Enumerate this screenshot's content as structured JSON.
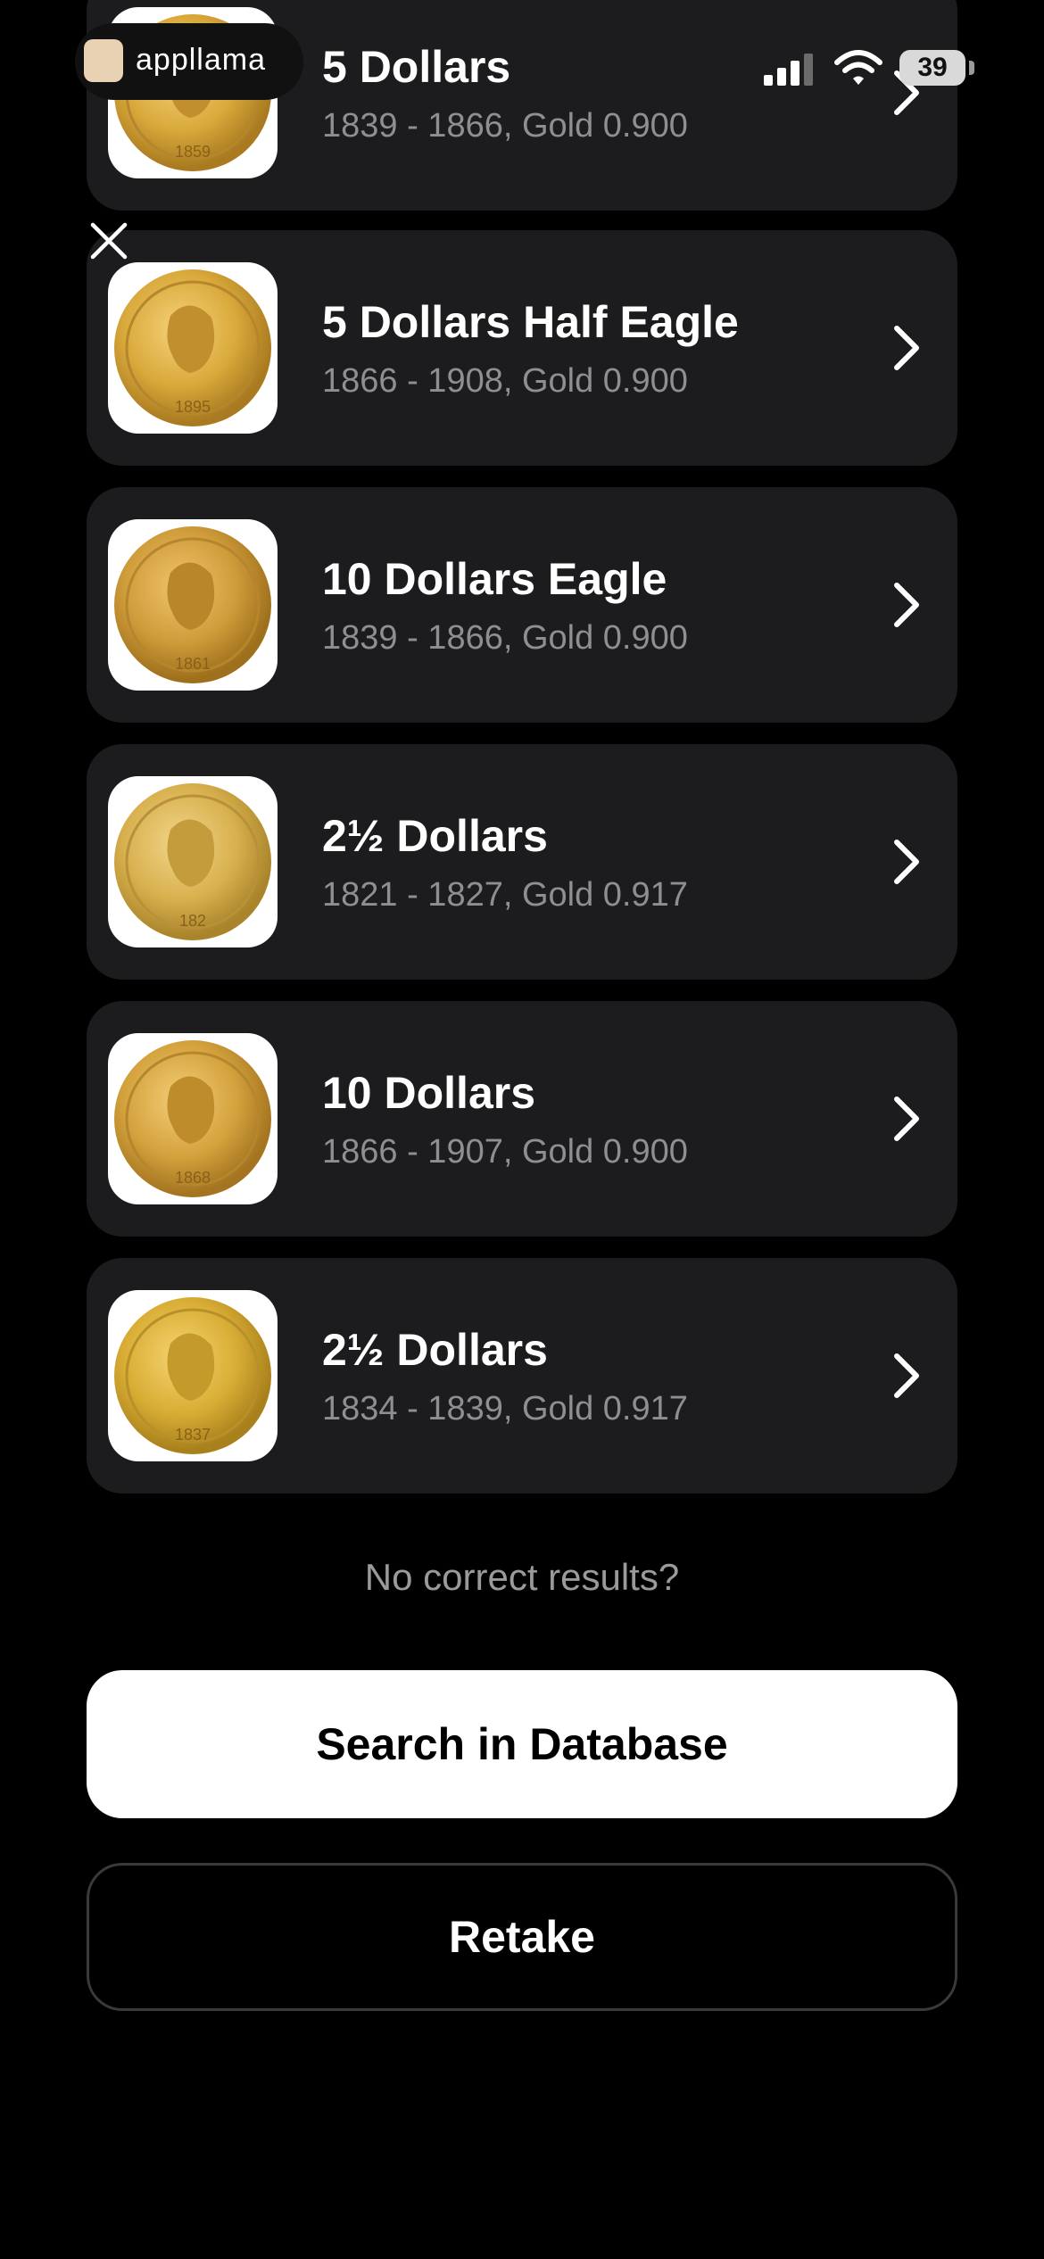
{
  "status_bar": {
    "app_label": "appllama",
    "battery_level": "39",
    "icons": [
      "llama-icon",
      "cellular-signal-icon",
      "wifi-icon",
      "battery-icon"
    ]
  },
  "close_icon": "close-icon",
  "results": [
    {
      "title": "5 Dollars",
      "subtitle": "1839 - 1866, Gold 0.900",
      "coin_year": "1859"
    },
    {
      "title": "5 Dollars Half Eagle",
      "subtitle": "1866 - 1908, Gold 0.900",
      "coin_year": "1895"
    },
    {
      "title": "10 Dollars Eagle",
      "subtitle": "1839 - 1866, Gold 0.900",
      "coin_year": "1861"
    },
    {
      "title": "2½ Dollars",
      "subtitle": "1821 - 1827, Gold 0.917",
      "coin_year": "182"
    },
    {
      "title": "10 Dollars",
      "subtitle": "1866 - 1907, Gold 0.900",
      "coin_year": "1868"
    },
    {
      "title": "2½ Dollars",
      "subtitle": "1834 - 1839, Gold 0.917",
      "coin_year": "1837"
    }
  ],
  "no_results_text": "No correct results?",
  "search_button_label": "Search in Database",
  "retake_button_label": "Retake",
  "colors": {
    "background": "#000000",
    "card": "#1c1c1e",
    "subtitle": "#8e8e93",
    "gold": "#d9a93b"
  }
}
